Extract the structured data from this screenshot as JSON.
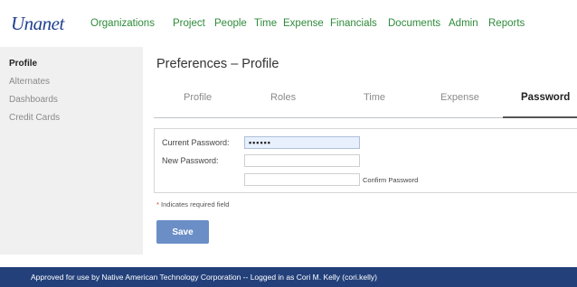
{
  "app": {
    "logo": "Unanet"
  },
  "nav": {
    "items": [
      "Organizations",
      "Project",
      "People",
      "Time",
      "Expense",
      "Financials",
      "Documents",
      "Admin",
      "Reports"
    ]
  },
  "sidebar": {
    "items": [
      "Profile",
      "Alternates",
      "Dashboards",
      "Credit Cards"
    ],
    "active": "Profile"
  },
  "page": {
    "title": "Preferences – Profile"
  },
  "tabs": {
    "items": [
      "Profile",
      "Roles",
      "Time",
      "Expense",
      "Password"
    ],
    "active": "Password"
  },
  "form": {
    "current_password_label": "Current Password:",
    "current_password_value": "••••••",
    "new_password_label": "New Password:",
    "new_password_value": "",
    "confirm_password_label": "Confirm Password",
    "confirm_password_value": ""
  },
  "required_note": {
    "star": "*",
    "text": "Indicates required field"
  },
  "save_button": {
    "label": "Save"
  },
  "footer": {
    "text": "Approved for use by Native American Technology Corporation -- Logged in as Cori M. Kelly (cori.kelly)"
  },
  "colors": {
    "nav_link": "#2e8b3a",
    "logo": "#1f3f8f",
    "footer_bg": "#23407a",
    "save_button_bg": "#6b8ec7",
    "required_star": "#d04a2a"
  }
}
